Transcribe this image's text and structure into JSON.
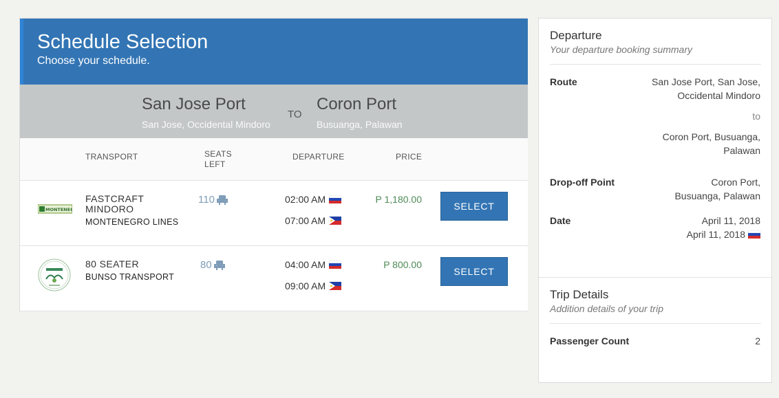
{
  "header": {
    "title": "Schedule Selection",
    "subtitle": "Choose your schedule."
  },
  "route": {
    "from_port": "San Jose Port",
    "from_location": "San Jose, Occidental Mindoro",
    "to_label": "TO",
    "to_port": "Coron Port",
    "to_location": "Busuanga, Palawan"
  },
  "table": {
    "columns": {
      "transport": "TRANSPORT",
      "seats_line1": "SEATS",
      "seats_line2": "LEFT",
      "departure": "DEPARTURE",
      "price": "PRICE"
    },
    "rows": [
      {
        "name_line1": "FASTCRAFT",
        "name_line2": "MINDORO",
        "operator": "MONTENEGRO LINES",
        "logo_icon": "montenegro-lines-logo",
        "seats": "110",
        "departures": [
          {
            "time": "02:00 AM",
            "flag": "ru-flag-icon"
          },
          {
            "time": "07:00 AM",
            "flag": "ph-flag-icon"
          }
        ],
        "price": "P 1,180.00",
        "select_label": "SELECT"
      },
      {
        "name_line1": "80 SEATER",
        "name_line2": "",
        "operator": "BUNSO TRANSPORT",
        "logo_icon": "bunso-transport-logo",
        "seats": "80",
        "departures": [
          {
            "time": "04:00 AM",
            "flag": "ru-flag-icon"
          },
          {
            "time": "09:00 AM",
            "flag": "ph-flag-icon"
          }
        ],
        "price": "P 800.00",
        "select_label": "SELECT"
      }
    ]
  },
  "logo_text": {
    "montenegro": "MONTENEGRO"
  },
  "sidebar": {
    "departure": {
      "title": "Departure",
      "subtitle": "Your departure booking summary",
      "route_label": "Route",
      "route_from_line1": "San Jose Port, San Jose,",
      "route_from_line2": "Occidental Mindoro",
      "route_to": "to",
      "route_to_line1": "Coron Port, Busuanga,",
      "route_to_line2": "Palawan",
      "dropoff_label": "Drop-off Point",
      "dropoff_line1": "Coron Port,",
      "dropoff_line2": "Busuanga, Palawan",
      "date_label": "Date",
      "date_line1": "April 11, 2018",
      "date_line2": "April 11, 2018"
    },
    "trip": {
      "title": "Trip Details",
      "subtitle": "Addition details of your trip",
      "passenger_label": "Passenger Count",
      "passenger_count": "2"
    }
  },
  "colors": {
    "primary": "#3375b4",
    "route_band": "#c4c7c8",
    "price": "#4e8a56",
    "seats": "#7f9db8"
  }
}
